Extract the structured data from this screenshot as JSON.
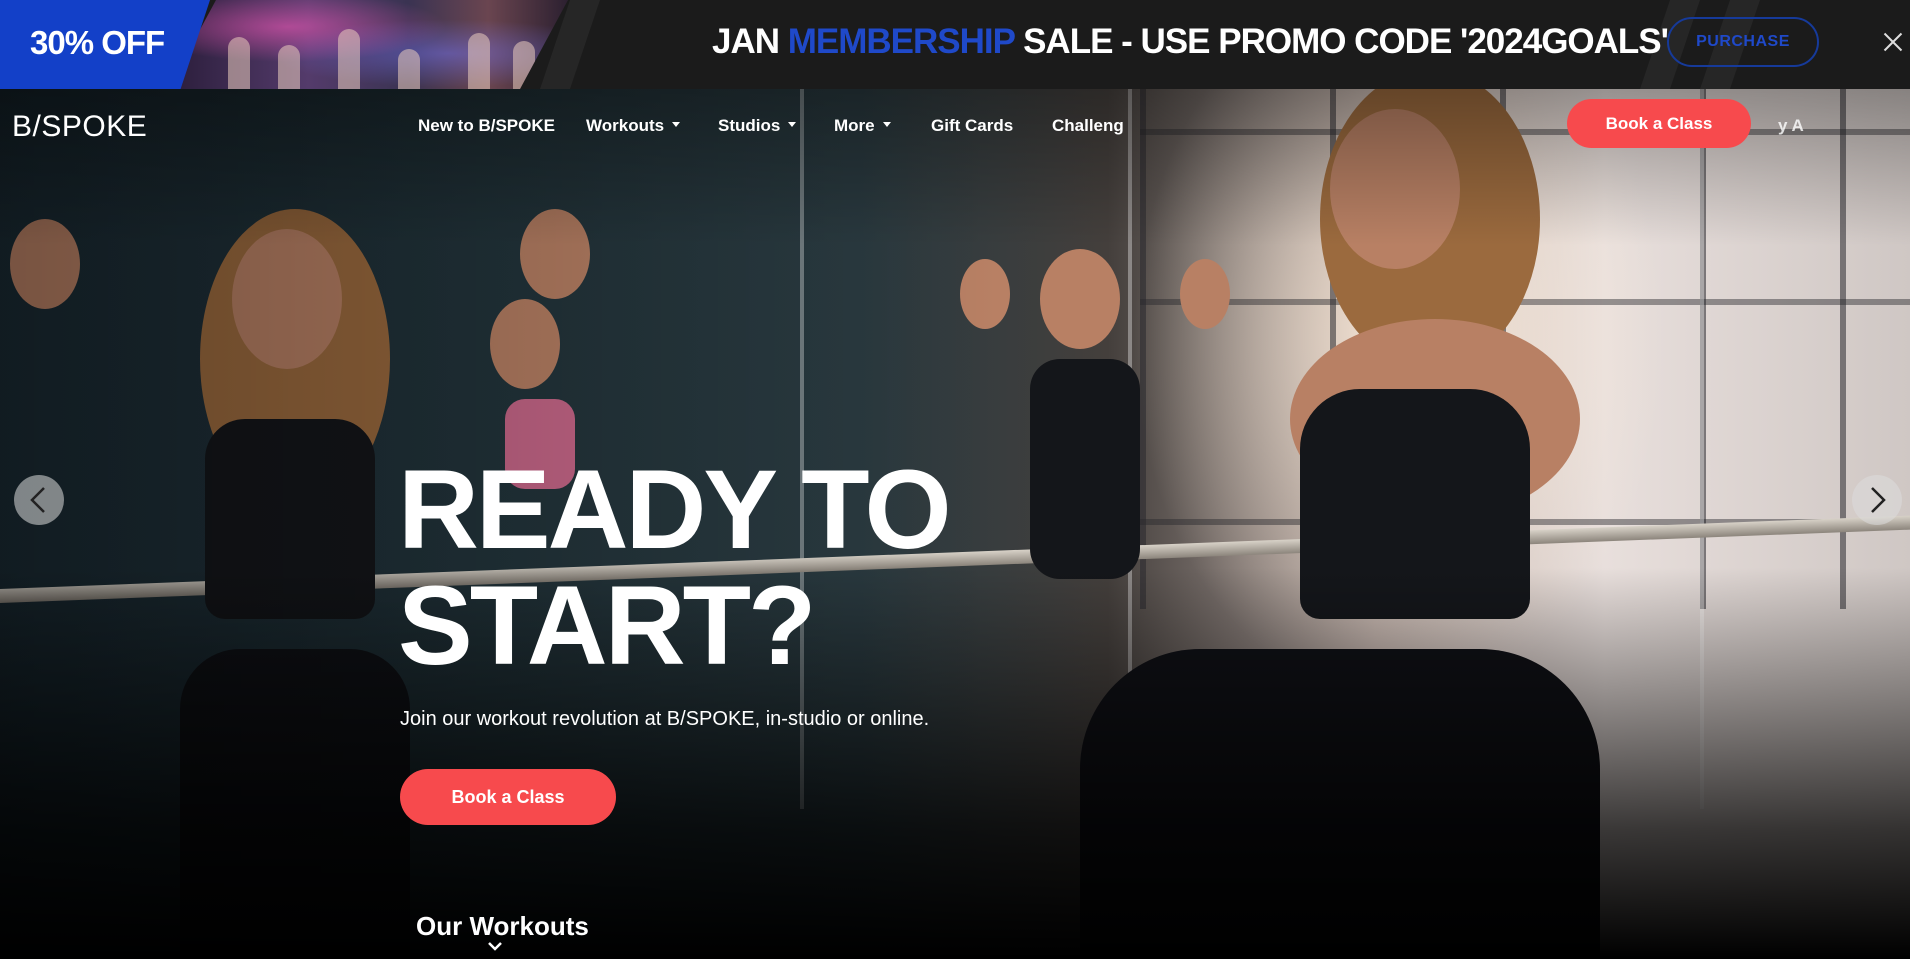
{
  "promo_banner": {
    "badge": "30% OFF",
    "message_prefix": "JAN ",
    "message_accent": "MEMBERSHIP",
    "message_suffix": " SALE - USE PROMO CODE '2024GOALS'",
    "purchase_label": "PURCHASE",
    "colors": {
      "accent": "#1f49c9",
      "badge_bg": "#1340c8"
    }
  },
  "nav": {
    "logo": "B/SPOKE",
    "items": [
      {
        "label": "New to B/SPOKE",
        "has_dropdown": false
      },
      {
        "label": "Workouts",
        "has_dropdown": true
      },
      {
        "label": "Studios",
        "has_dropdown": true
      },
      {
        "label": "More",
        "has_dropdown": true
      },
      {
        "label": "Gift Cards",
        "has_dropdown": false
      },
      {
        "label": "Challeng",
        "has_dropdown": false
      }
    ],
    "book_label": "Book a Class",
    "account_label": "y A"
  },
  "hero": {
    "title": "READY TO\nSTART?",
    "subtitle": "Join our workout revolution at B/SPOKE, in-studio or online.",
    "cta_label": "Book a Class",
    "workouts_label": "Our Workouts",
    "colors": {
      "cta": "#f74a4d"
    }
  }
}
